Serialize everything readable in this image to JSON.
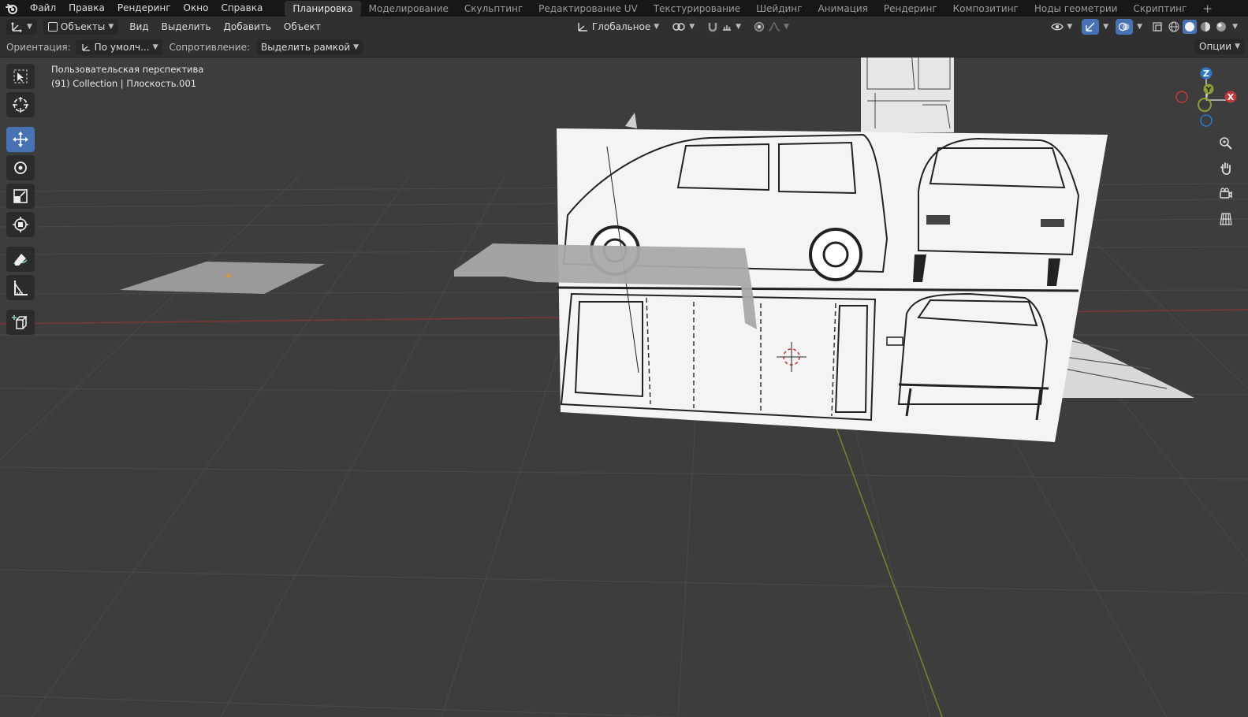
{
  "topbar": {
    "menus": [
      "Файл",
      "Правка",
      "Рендеринг",
      "Окно",
      "Справка"
    ],
    "workspaces": [
      "Планировка",
      "Моделирование",
      "Скульптинг",
      "Редактирование UV",
      "Текстурирование",
      "Шейдинг",
      "Анимация",
      "Рендеринг",
      "Композитинг",
      "Ноды геометрии",
      "Скриптинг"
    ],
    "active_workspace": "Планировка",
    "add_tab": "+"
  },
  "header": {
    "mode": "Объекты",
    "menus": [
      "Вид",
      "Выделить",
      "Добавить",
      "Объект"
    ],
    "transform_orientation": "Глобальное"
  },
  "tool_settings": {
    "orientation_label": "Ориентация:",
    "orientation_value": "По умолч...",
    "drag_label": "Сопротивление:",
    "drag_value": "Выделить рамкой",
    "options": "Опции"
  },
  "viewport": {
    "view_name": "Пользовательская перспектива",
    "object_info": "(91) Collection | Плоскость.001",
    "gizmo": {
      "z": "Z",
      "y": "Y",
      "x": "X"
    }
  },
  "colors": {
    "accent": "#4772b3",
    "x_axis": "#c4393c",
    "y_axis": "#8aa132",
    "z_axis": "#2d78c8"
  },
  "icons": {
    "tools": [
      "select-box-icon",
      "cursor-icon",
      "move-icon",
      "rotate-icon",
      "scale-icon",
      "transform-icon",
      "annotate-icon",
      "measure-icon",
      "add-cube-icon"
    ],
    "navigation": [
      "zoom-icon",
      "pan-hand-icon",
      "camera-icon",
      "grid-ortho-icon"
    ]
  }
}
